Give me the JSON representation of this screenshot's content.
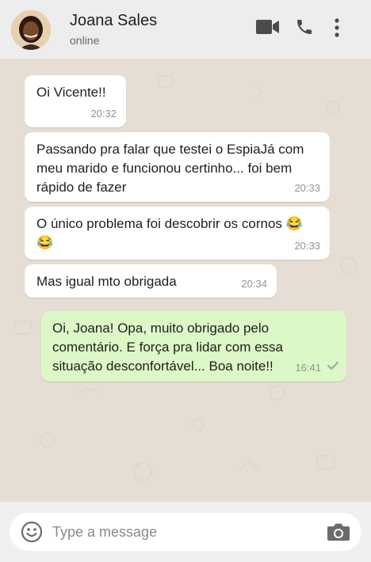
{
  "header": {
    "contact_name": "Joana Sales",
    "status": "online",
    "icons": [
      "video-icon",
      "phone-icon",
      "more-vert-icon"
    ]
  },
  "messages": [
    {
      "direction": "in",
      "text": "Oi Vicente!!",
      "time": "20:32"
    },
    {
      "direction": "in",
      "text": "Passando pra falar que testei o EspiaJá com\nmeu marido e funcionou certinho... foi bem\nrápido de fazer",
      "time": "20:33"
    },
    {
      "direction": "in",
      "text": "O único problema foi descobrir os cornos 😂\n😂",
      "time": "20:33"
    },
    {
      "direction": "in",
      "text": "Mas igual mto obrigada",
      "time": "20:34"
    },
    {
      "direction": "out",
      "text": "Oi, Joana! Opa, muito obrigado pelo\ncomentário. E força pra lidar com essa\nsituação desconfortável... Boa noite!!",
      "time": "16:41",
      "status": "sent"
    }
  ],
  "composer": {
    "placeholder": "Type a message",
    "icons": [
      "emoji-icon",
      "camera-icon"
    ]
  },
  "colors": {
    "header_bg": "#ededed",
    "chat_bg": "#e6ddd4",
    "incoming_bubble": "#ffffff",
    "outgoing_bubble": "#dcf8c6",
    "icon": "#4a4a4a"
  }
}
